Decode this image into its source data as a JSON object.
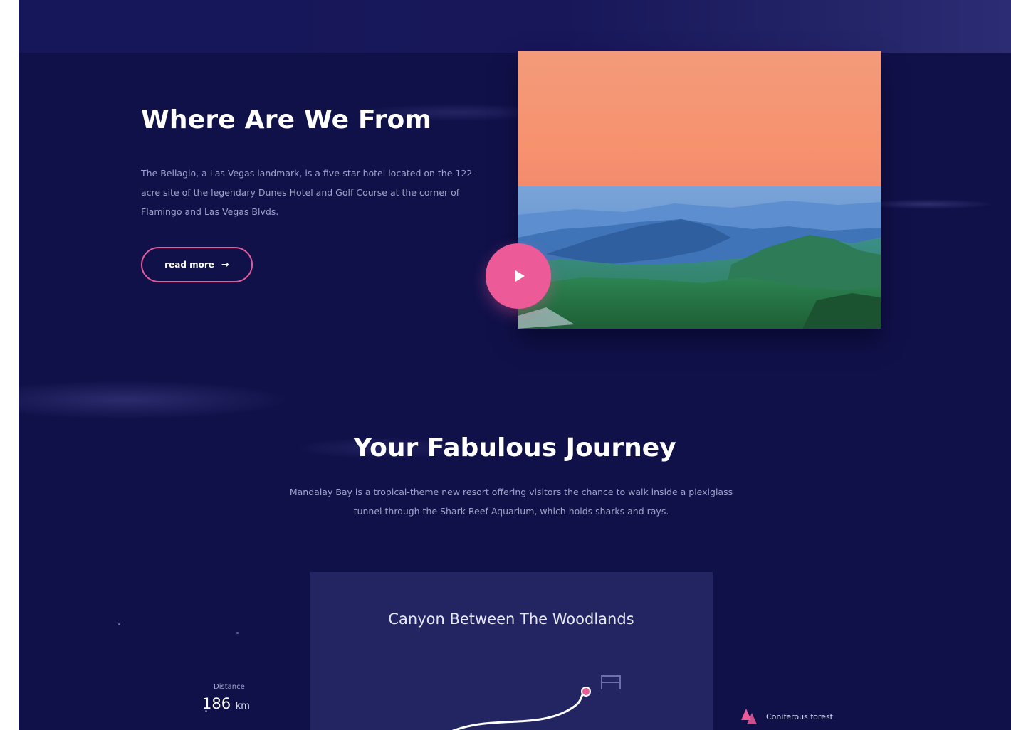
{
  "about": {
    "title": "Where Are We From",
    "text": "The Bellagio, a Las Vegas landmark, is a five-star hotel located on the 122-acre site of the legendary Dunes Hotel and Golf Course at the corner of Flamingo and Las Vegas Blvds.",
    "read_more_label": "read more",
    "read_more_arrow": "→"
  },
  "media": {
    "play_icon": "play-icon"
  },
  "journey": {
    "title": "Your Fabulous Journey",
    "text": "Mandalay Bay is a tropical-theme new resort offering visitors the chance to walk inside a plexiglass tunnel through the Shark Reef Aquarium, which holds sharks and rays."
  },
  "route_card": {
    "title": "Canyon Between The Woodlands",
    "end_icon": "flag-icon"
  },
  "stats": {
    "distance_label": "Distance",
    "distance_value": "186",
    "distance_unit": "km"
  },
  "terrain": {
    "icon": "tree-icon",
    "label": "Coniferous forest"
  },
  "colors": {
    "background": "#11114a",
    "card": "#232462",
    "accent": "#ec5a98",
    "text_muted": "#9ea3c8"
  }
}
